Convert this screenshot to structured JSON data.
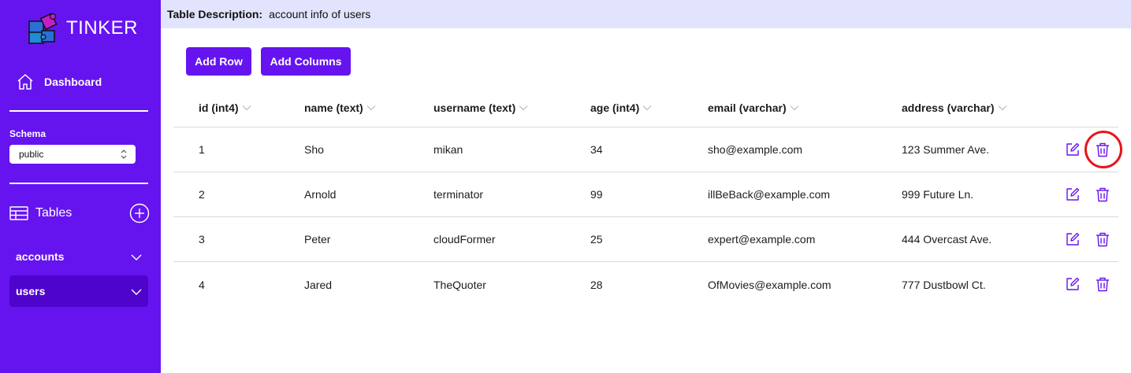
{
  "sidebar": {
    "brand": "TINKER",
    "dashboard_label": "Dashboard",
    "schema": {
      "label": "Schema",
      "selected": "public"
    },
    "tables_label": "Tables",
    "tables": [
      {
        "label": "accounts",
        "active": false
      },
      {
        "label": "users",
        "active": true
      }
    ]
  },
  "description": {
    "key": "Table Description:",
    "value": "account info of users"
  },
  "toolbar": {
    "add_row": "Add Row",
    "add_columns": "Add Columns"
  },
  "table": {
    "columns": [
      "id (int4)",
      "name (text)",
      "username (text)",
      "age (int4)",
      "email (varchar)",
      "address (varchar)"
    ],
    "rows": [
      [
        "1",
        "Sho",
        "mikan",
        "34",
        "sho@example.com",
        "123 Summer Ave."
      ],
      [
        "2",
        "Arnold",
        "terminator",
        "99",
        "illBeBack@example.com",
        "999 Future Ln."
      ],
      [
        "3",
        "Peter",
        "cloudFormer",
        "25",
        "expert@example.com",
        "444 Overcast Ave."
      ],
      [
        "4",
        "Jared",
        "TheQuoter",
        "28",
        "OfMovies@example.com",
        "777 Dustbowl Ct."
      ]
    ]
  },
  "colors": {
    "accent": "#6514f0",
    "accent_dark": "#4f04cc",
    "desc_bar": "#e1e4fc",
    "highlight": "#e8141c"
  },
  "icons": [
    "puzzle-logo-icon",
    "home-icon",
    "updown-icon",
    "table-icon",
    "plus-circle-icon",
    "chevron-down-icon",
    "sort-chevron-icon",
    "edit-icon",
    "trash-icon"
  ]
}
